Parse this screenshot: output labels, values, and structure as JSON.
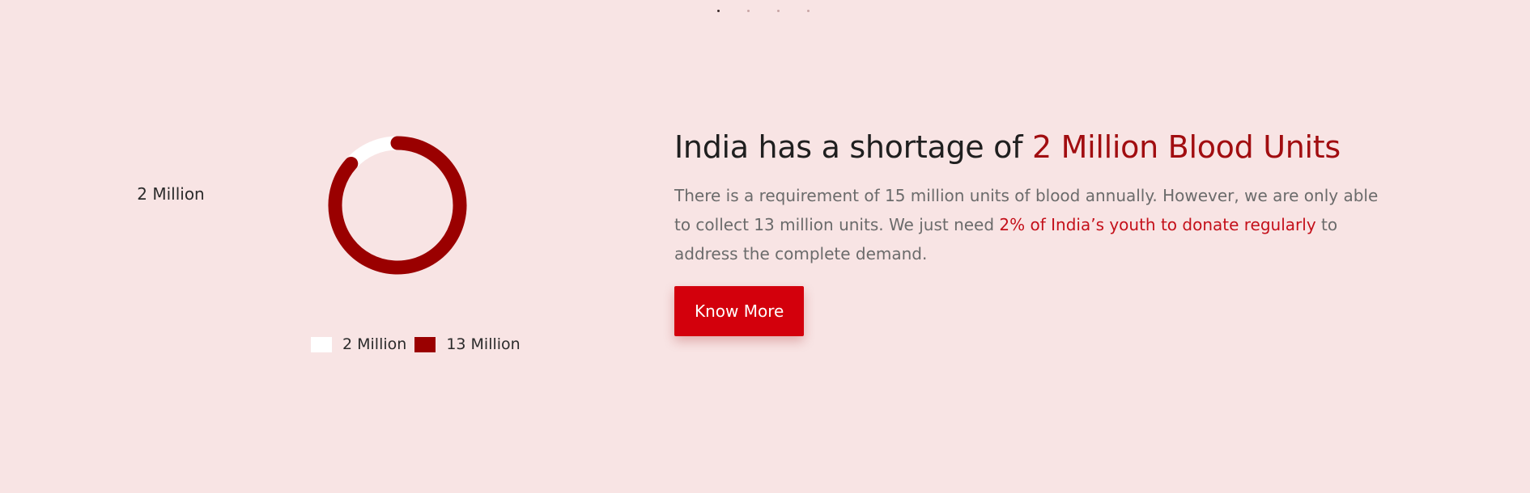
{
  "carousel": {
    "dot_count": 4,
    "active_index": 0
  },
  "chart_data": {
    "type": "pie",
    "center_label": "2 Million",
    "categories": [
      "2 Million",
      "13 Million"
    ],
    "values": [
      2,
      13
    ],
    "colors": [
      "#ffffff",
      "#9a0000"
    ]
  },
  "legend": [
    {
      "label": "2 Million",
      "color": "#ffffff"
    },
    {
      "label": "13 Million",
      "color": "#9a0000"
    }
  ],
  "headline": {
    "prefix": "India has a shortage of ",
    "highlight": "2 Million Blood Units"
  },
  "body": {
    "part1": "There is a requirement of 15 million units of blood annually. However, we are only able to collect 13 million units. We just need ",
    "highlight": "2% of India’s youth to donate regularly",
    "part2": " to address the complete demand."
  },
  "cta": {
    "label": "Know More"
  },
  "colors": {
    "background": "#f8e4e4",
    "accent": "#d3000c",
    "dark_red": "#9a0000",
    "headline_red": "#a10d10"
  }
}
